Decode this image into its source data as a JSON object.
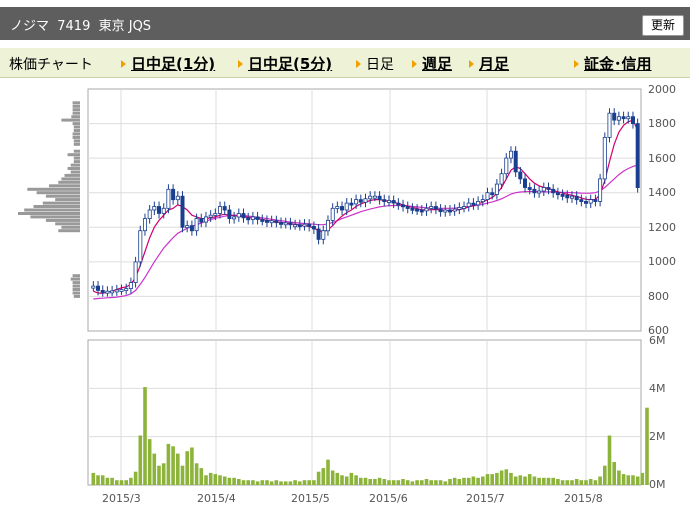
{
  "header": {
    "title": "ノジマ  7419  東京 JQS",
    "refresh_label": "更新"
  },
  "nav": {
    "label": "株価チャート",
    "intraday_1": "日中足(1分)",
    "intraday_5": "日中足(5分)",
    "daily": "日足",
    "weekly": "週足",
    "monthly": "月足",
    "margin": "証金･信用"
  },
  "colors": {
    "header_bg": "#5e5e5e",
    "nav_bg": "#eef3d8",
    "candle": "#1a3f8f",
    "ma_short": "#d0006f",
    "ma_long": "#cc33cc",
    "volume": "#8db43a",
    "volume_profile": "#999999",
    "grid": "#dddddd",
    "nav_arrow": "#f0a000"
  },
  "chart_data": [
    {
      "type": "candlestick",
      "title": "",
      "y_ticks": [
        "2000",
        "1800",
        "1600",
        "1400",
        "1200",
        "1000",
        "800",
        "600"
      ],
      "ylim": [
        600,
        2000
      ],
      "x_tick_labels": [
        "2015/3",
        "2015/4",
        "2015/5",
        "2015/6",
        "2015/7",
        "2015/8"
      ],
      "grid": true,
      "series": [
        {
          "name": "",
          "kind": "close",
          "values": [
            860,
            835,
            828,
            830,
            832,
            838,
            840,
            845,
            880,
            1000,
            1180,
            1250,
            1300,
            1320,
            1280,
            1310,
            1420,
            1360,
            1380,
            1200,
            1210,
            1180,
            1250,
            1230,
            1260,
            1270,
            1280,
            1320,
            1300,
            1250,
            1260,
            1280,
            1255,
            1245,
            1260,
            1245,
            1240,
            1230,
            1238,
            1228,
            1222,
            1226,
            1215,
            1215,
            1210,
            1218,
            1205,
            1190,
            1130,
            1180,
            1240,
            1310,
            1320,
            1300,
            1340,
            1335,
            1360,
            1345,
            1365,
            1380,
            1380,
            1360,
            1350,
            1355,
            1340,
            1330,
            1320,
            1310,
            1305,
            1300,
            1295,
            1310,
            1320,
            1305,
            1290,
            1300,
            1295,
            1305,
            1315,
            1320,
            1340,
            1330,
            1350,
            1360,
            1400,
            1390,
            1450,
            1510,
            1600,
            1640,
            1520,
            1480,
            1430,
            1420,
            1400,
            1410,
            1430,
            1420,
            1400,
            1390,
            1385,
            1370,
            1380,
            1360,
            1350,
            1340,
            1360,
            1350,
            1480,
            1720,
            1860,
            1820,
            1840,
            1830,
            1840,
            1800,
            1430
          ]
        },
        {
          "name": "",
          "kind": "moving_average_short",
          "values": [
            830,
            820,
            818,
            825,
            830,
            840,
            850,
            855,
            870,
            910,
            980,
            1060,
            1140,
            1200,
            1240,
            1270,
            1300,
            1310,
            1330,
            1320,
            1300,
            1270,
            1260,
            1250,
            1250,
            1255,
            1260,
            1270,
            1275,
            1270,
            1268,
            1265,
            1262,
            1258,
            1253,
            1250,
            1246,
            1240,
            1236,
            1232,
            1228,
            1224,
            1220,
            1217,
            1214,
            1210,
            1205,
            1195,
            1180,
            1175,
            1185,
            1210,
            1240,
            1265,
            1285,
            1300,
            1320,
            1335,
            1345,
            1355,
            1360,
            1360,
            1355,
            1350,
            1345,
            1338,
            1330,
            1322,
            1315,
            1308,
            1302,
            1300,
            1302,
            1303,
            1300,
            1298,
            1297,
            1298,
            1302,
            1308,
            1318,
            1325,
            1335,
            1345,
            1360,
            1372,
            1395,
            1430,
            1480,
            1530,
            1550,
            1540,
            1510,
            1480,
            1455,
            1440,
            1430,
            1425,
            1415,
            1405,
            1398,
            1390,
            1385,
            1378,
            1370,
            1362,
            1360,
            1360,
            1390,
            1470,
            1580,
            1680,
            1750,
            1790,
            1810,
            1820,
            1760
          ]
        },
        {
          "name": "",
          "kind": "moving_average_long",
          "values": [
            785,
            788,
            790,
            792,
            794,
            796,
            800,
            805,
            815,
            835,
            870,
            910,
            955,
            1000,
            1040,
            1080,
            1110,
            1140,
            1165,
            1180,
            1195,
            1205,
            1215,
            1225,
            1235,
            1245,
            1252,
            1258,
            1264,
            1268,
            1270,
            1270,
            1268,
            1265,
            1262,
            1258,
            1255,
            1250,
            1246,
            1242,
            1238,
            1234,
            1230,
            1227,
            1224,
            1222,
            1220,
            1218,
            1215,
            1215,
            1220,
            1228,
            1238,
            1250,
            1260,
            1270,
            1280,
            1290,
            1298,
            1305,
            1312,
            1318,
            1322,
            1325,
            1326,
            1326,
            1325,
            1323,
            1320,
            1318,
            1315,
            1313,
            1312,
            1311,
            1310,
            1310,
            1310,
            1311,
            1313,
            1316,
            1320,
            1324,
            1328,
            1333,
            1340,
            1347,
            1355,
            1365,
            1378,
            1392,
            1400,
            1404,
            1406,
            1407,
            1407,
            1406,
            1405,
            1405,
            1404,
            1403,
            1402,
            1401,
            1400,
            1399,
            1398,
            1397,
            1398,
            1400,
            1410,
            1430,
            1455,
            1480,
            1505,
            1525,
            1540,
            1552,
            1560
          ]
        }
      ]
    },
    {
      "type": "bar",
      "title": "",
      "y_ticks": [
        "6M",
        "4M",
        "2M",
        "0M"
      ],
      "ylim": [
        0,
        6
      ],
      "unit": "M",
      "x_tick_labels": [
        "2015/3",
        "2015/4",
        "2015/5",
        "2015/6",
        "2015/7",
        "2015/8"
      ],
      "series": [
        {
          "name": "",
          "values": [
            0.5,
            0.4,
            0.4,
            0.3,
            0.3,
            0.2,
            0.2,
            0.2,
            0.3,
            0.55,
            2.05,
            4.05,
            1.9,
            1.3,
            0.8,
            0.9,
            1.7,
            1.6,
            1.3,
            0.8,
            1.4,
            1.55,
            0.9,
            0.7,
            0.4,
            0.5,
            0.45,
            0.4,
            0.35,
            0.3,
            0.3,
            0.25,
            0.2,
            0.2,
            0.2,
            0.15,
            0.2,
            0.2,
            0.15,
            0.2,
            0.15,
            0.15,
            0.15,
            0.2,
            0.15,
            0.2,
            0.2,
            0.2,
            0.55,
            0.7,
            1.05,
            0.6,
            0.5,
            0.4,
            0.35,
            0.5,
            0.4,
            0.3,
            0.3,
            0.25,
            0.25,
            0.3,
            0.25,
            0.2,
            0.2,
            0.2,
            0.25,
            0.2,
            0.15,
            0.2,
            0.2,
            0.25,
            0.2,
            0.2,
            0.2,
            0.15,
            0.25,
            0.3,
            0.25,
            0.3,
            0.3,
            0.35,
            0.3,
            0.35,
            0.45,
            0.45,
            0.5,
            0.6,
            0.65,
            0.5,
            0.35,
            0.4,
            0.35,
            0.45,
            0.35,
            0.3,
            0.3,
            0.3,
            0.3,
            0.25,
            0.2,
            0.2,
            0.2,
            0.25,
            0.2,
            0.2,
            0.25,
            0.2,
            0.35,
            0.8,
            2.05,
            0.95,
            0.6,
            0.45,
            0.4,
            0.4,
            0.35,
            0.5,
            3.2
          ]
        }
      ]
    },
    {
      "type": "bar",
      "title": "",
      "orientation": "horizontal",
      "bins": [
        1980,
        1960,
        1940,
        1920,
        1900,
        1880,
        1860,
        1840,
        1820,
        1800,
        1780,
        1760,
        1740,
        1720,
        1700,
        1680,
        1660,
        1640,
        1620,
        1600,
        1580,
        1560,
        1540,
        1520,
        1500,
        1480,
        1460,
        1440,
        1420,
        1400,
        1380,
        1360,
        1340,
        1320,
        1300,
        1280,
        1260,
        1240,
        1220,
        1200,
        1180,
        1160,
        1140,
        1120,
        1100,
        1080,
        1060,
        1040,
        1020,
        1000,
        980,
        960,
        940,
        920,
        900,
        880,
        860,
        840,
        820,
        800
      ],
      "values": [
        0,
        0,
        0,
        0.12,
        0.12,
        0.12,
        0.12,
        0.14,
        0.3,
        0.12,
        0.1,
        0.1,
        0.12,
        0.12,
        0.1,
        0.1,
        0,
        0.1,
        0.2,
        0.1,
        0.1,
        0.15,
        0.2,
        0.15,
        0.25,
        0.3,
        0.35,
        0.5,
        0.85,
        0.7,
        0.55,
        0.4,
        0.6,
        0.75,
        0.9,
        1.0,
        0.8,
        0.55,
        0.4,
        0.3,
        0.35,
        0,
        0,
        0,
        0,
        0,
        0,
        0,
        0,
        0,
        0,
        0,
        0,
        0.12,
        0.15,
        0.12,
        0.12,
        0.12,
        0.12,
        0.1
      ]
    }
  ]
}
